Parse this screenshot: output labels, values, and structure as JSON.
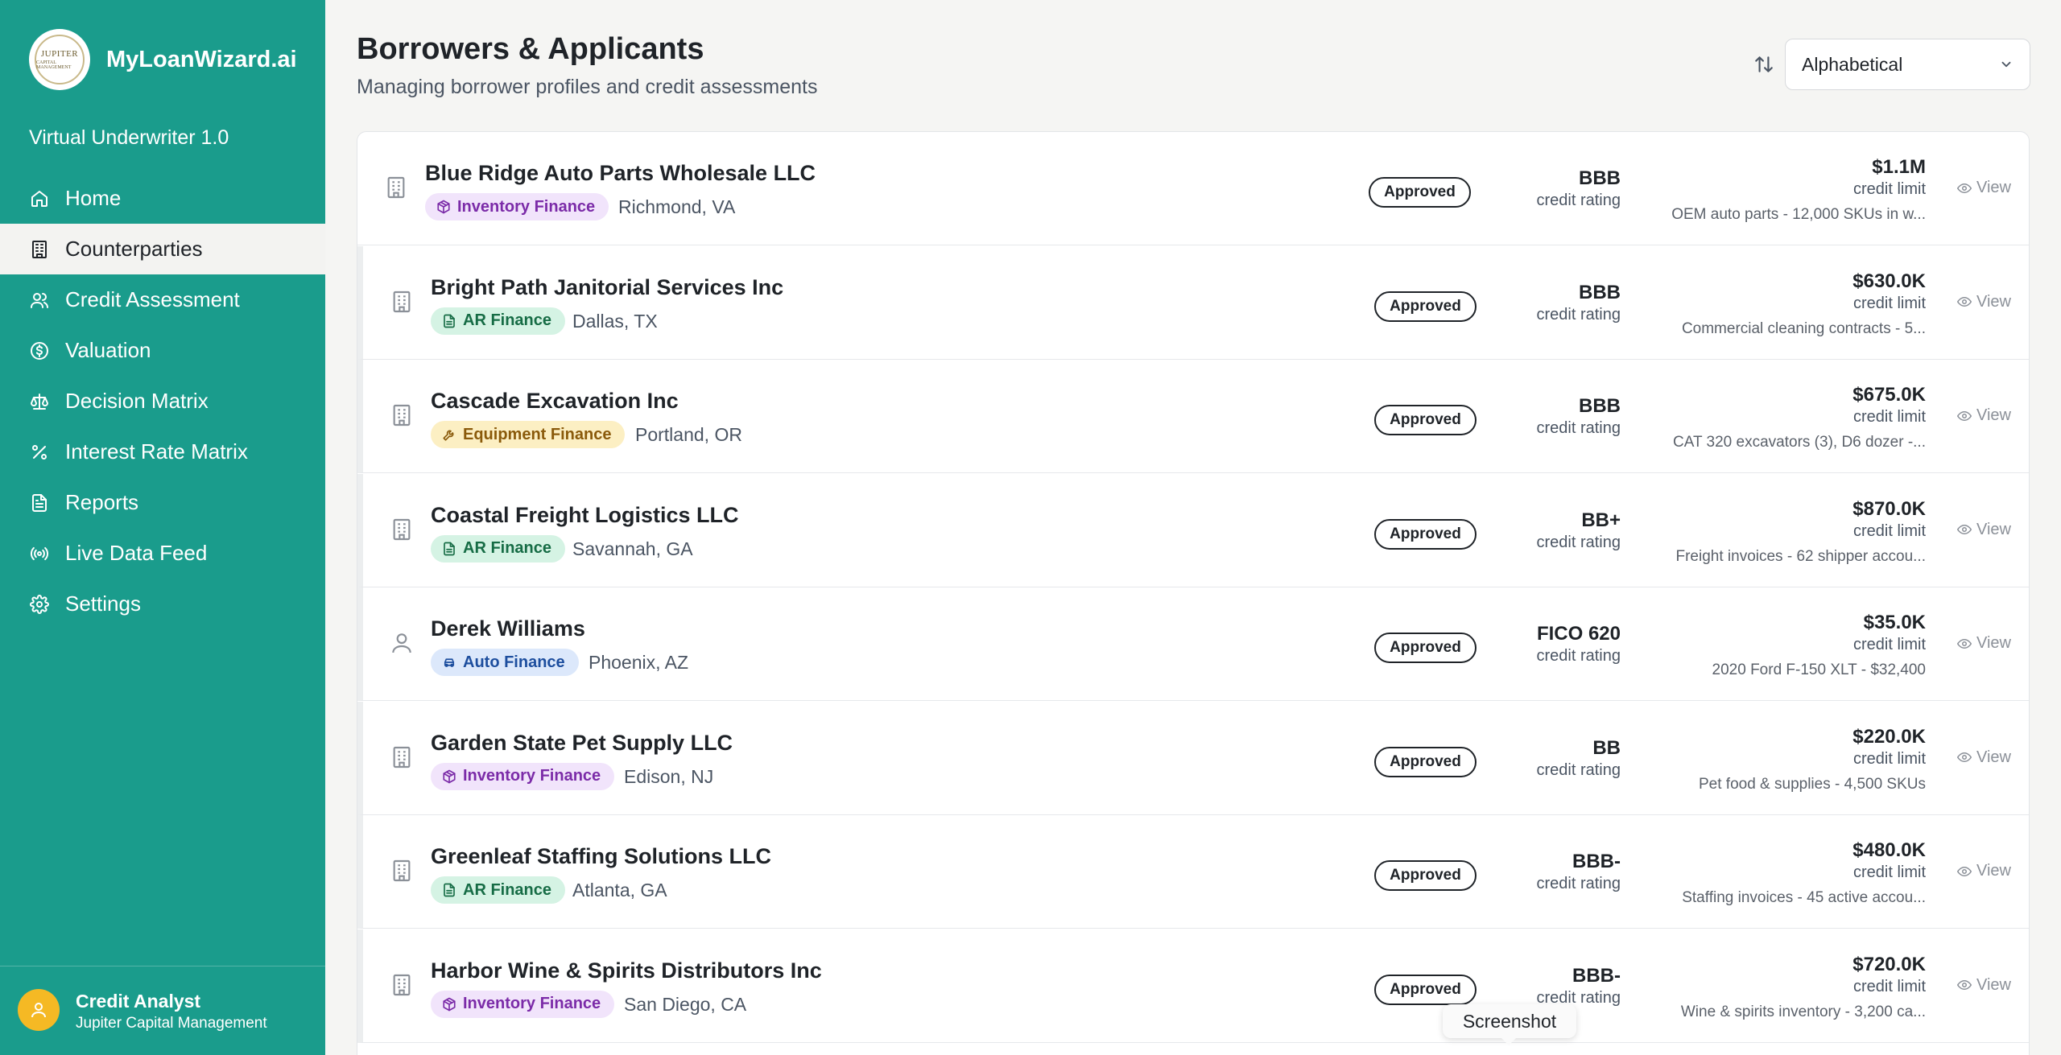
{
  "sidebar": {
    "logo_text": "JUPITER",
    "logo_sub": "CAPITAL MANAGEMENT",
    "brand": "MyLoanWizard.ai",
    "version": "Virtual Underwriter 1.0",
    "items": [
      {
        "label": "Home",
        "icon": "home-icon"
      },
      {
        "label": "Counterparties",
        "icon": "building-icon",
        "active": true
      },
      {
        "label": "Credit Assessment",
        "icon": "users-icon"
      },
      {
        "label": "Valuation",
        "icon": "dollar-circle-icon"
      },
      {
        "label": "Decision Matrix",
        "icon": "scale-icon"
      },
      {
        "label": "Interest Rate Matrix",
        "icon": "percent-icon"
      },
      {
        "label": "Reports",
        "icon": "file-text-icon"
      },
      {
        "label": "Live Data Feed",
        "icon": "radio-icon"
      },
      {
        "label": "Settings",
        "icon": "gear-icon"
      }
    ],
    "user": {
      "name": "Credit Analyst",
      "org": "Jupiter Capital Management"
    }
  },
  "header": {
    "title": "Borrowers & Applicants",
    "subtitle": "Managing borrower profiles and credit assessments",
    "sort_value": "Alphabetical"
  },
  "rows": [
    {
      "name": "Blue Ridge Auto Parts Wholesale LLC",
      "type": "Inventory Finance",
      "type_key": "inventory",
      "location": "Richmond, VA",
      "status": "Approved",
      "rating": "BBB",
      "rating_label": "credit rating",
      "limit": "$1.1M",
      "limit_label": "credit limit",
      "desc": "OEM auto parts - 12,000 SKUs in w...",
      "view": "View",
      "entity": "company"
    },
    {
      "name": "Bright Path Janitorial Services Inc",
      "type": "AR Finance",
      "type_key": "ar",
      "location": "Dallas, TX",
      "status": "Approved",
      "rating": "BBB",
      "rating_label": "credit rating",
      "limit": "$630.0K",
      "limit_label": "credit limit",
      "desc": "Commercial cleaning contracts - 5...",
      "view": "View",
      "entity": "company"
    },
    {
      "name": "Cascade Excavation Inc",
      "type": "Equipment Finance",
      "type_key": "equipment",
      "location": "Portland, OR",
      "status": "Approved",
      "rating": "BBB",
      "rating_label": "credit rating",
      "limit": "$675.0K",
      "limit_label": "credit limit",
      "desc": "CAT 320 excavators (3), D6 dozer -...",
      "view": "View",
      "entity": "company"
    },
    {
      "name": "Coastal Freight Logistics LLC",
      "type": "AR Finance",
      "type_key": "ar",
      "location": "Savannah, GA",
      "status": "Approved",
      "rating": "BB+",
      "rating_label": "credit rating",
      "limit": "$870.0K",
      "limit_label": "credit limit",
      "desc": "Freight invoices - 62 shipper accou...",
      "view": "View",
      "entity": "company"
    },
    {
      "name": "Derek Williams",
      "type": "Auto Finance",
      "type_key": "auto",
      "location": "Phoenix, AZ",
      "status": "Approved",
      "rating": "FICO 620",
      "rating_label": "credit rating",
      "limit": "$35.0K",
      "limit_label": "credit limit",
      "desc": "2020 Ford F-150 XLT - $32,400",
      "view": "View",
      "entity": "person"
    },
    {
      "name": "Garden State Pet Supply LLC",
      "type": "Inventory Finance",
      "type_key": "inventory",
      "location": "Edison, NJ",
      "status": "Approved",
      "rating": "BB",
      "rating_label": "credit rating",
      "limit": "$220.0K",
      "limit_label": "credit limit",
      "desc": "Pet food & supplies - 4,500 SKUs",
      "view": "View",
      "entity": "company"
    },
    {
      "name": "Greenleaf Staffing Solutions LLC",
      "type": "AR Finance",
      "type_key": "ar",
      "location": "Atlanta, GA",
      "status": "Approved",
      "rating": "BBB-",
      "rating_label": "credit rating",
      "limit": "$480.0K",
      "limit_label": "credit limit",
      "desc": "Staffing invoices - 45 active accou...",
      "view": "View",
      "entity": "company"
    },
    {
      "name": "Harbor Wine & Spirits Distributors Inc",
      "type": "Inventory Finance",
      "type_key": "inventory",
      "location": "San Diego, CA",
      "status": "Approved",
      "rating": "BBB-",
      "rating_label": "credit rating",
      "limit": "$720.0K",
      "limit_label": "credit limit",
      "desc": "Wine & spirits inventory - 3,200 ca...",
      "view": "View",
      "entity": "company"
    }
  ],
  "tooltip": "Screenshot"
}
